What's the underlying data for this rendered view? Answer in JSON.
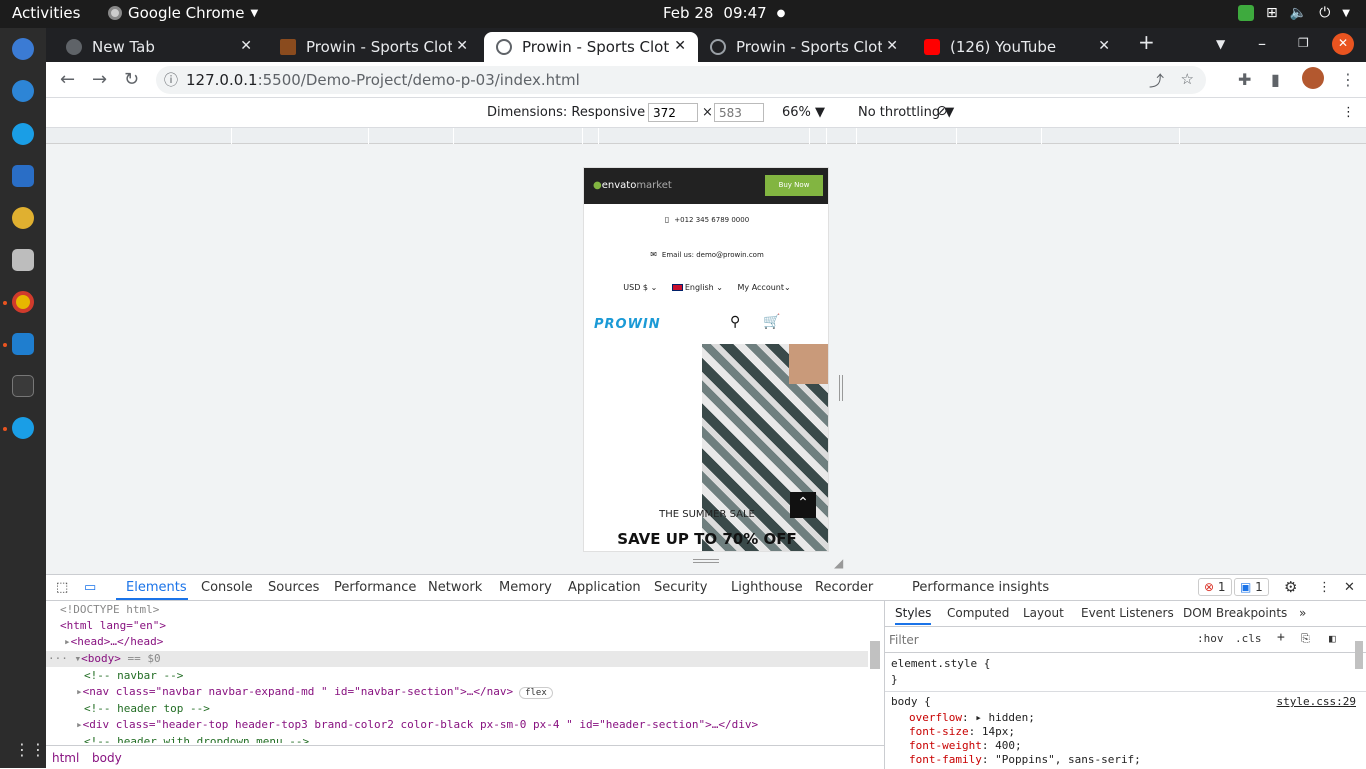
{
  "system": {
    "activities": "Activities",
    "app_name": "Google Chrome",
    "date": "Feb 28",
    "time": "09:47"
  },
  "tabs": [
    {
      "title": "New Tab",
      "favicon_color": "#5f6368"
    },
    {
      "title": "Prowin - Sports Clothi",
      "favicon_color": "#8a4b1e"
    },
    {
      "title": "Prowin - Sports Clothi",
      "favicon_color": "#5f6368"
    },
    {
      "title": "Prowin - Sports Clothi",
      "favicon_color": "#9aa0a6"
    },
    {
      "title": "(126) YouTube",
      "favicon_color": "#ff0000"
    }
  ],
  "address": {
    "host": "127.0.0.1",
    "path": ":5500/Demo-Project/demo-p-03/index.html"
  },
  "device_toolbar": {
    "dimensions_label": "Dimensions: Responsive",
    "width": "372",
    "height": "583",
    "zoom": "66%",
    "throttling": "No throttling"
  },
  "page": {
    "envato_logo": "envato",
    "envato_logo2": "market",
    "buy_now": "Buy Now",
    "phone": "+012 345 6789 0000",
    "email": "Email us: demo@prowin.com",
    "currency": "USD $",
    "language": "English",
    "account": "My Account",
    "brand": "PROWIN",
    "hero_kicker": "THE SUMMER SALE",
    "hero_title": "SAVE UP TO 70% OFF"
  },
  "devtools": {
    "tabs": [
      "Elements",
      "Console",
      "Sources",
      "Performance",
      "Network",
      "Memory",
      "Application",
      "Security",
      "Lighthouse",
      "Recorder",
      "Performance insights"
    ],
    "error_count": "1",
    "message_count": "1",
    "lines": {
      "doctype": "<!DOCTYPE html>",
      "html_open": "<html lang=\"en\">",
      "head": "<head>…</head>",
      "body": "<body>",
      "body_eq": " == $0",
      "c_navbar": "<!-- navbar -->",
      "nav_open": "<nav class=\"navbar navbar-expand-md  \" id=\"navbar-section\">…</nav>",
      "nav_badge": "flex",
      "c_header_top": "<!-- header top -->",
      "div_header": "<div class=\"header-top header-top3 brand-color2 color-black  px-sm-0 px-4 \" id=\"header-section\">…</div>",
      "c_header_dd": "<!-- header with dropdown menu -->"
    },
    "crumbs": [
      "html",
      "body"
    ],
    "styles_tabs": [
      "Styles",
      "Computed",
      "Layout",
      "Event Listeners",
      "DOM Breakpoints"
    ],
    "filter_placeholder": "Filter",
    "hov": ":hov",
    "cls": ".cls",
    "element_style": "element.style {",
    "close_brace": "}",
    "body_rule": "body {",
    "body_source": "style.css:29",
    "props": [
      {
        "name": "overflow",
        "value": "hidden;"
      },
      {
        "name": "font-size",
        "value": "14px;"
      },
      {
        "name": "font-weight",
        "value": "400;"
      },
      {
        "name": "font-family",
        "value": "\"Poppins\", sans-serif;"
      }
    ]
  }
}
